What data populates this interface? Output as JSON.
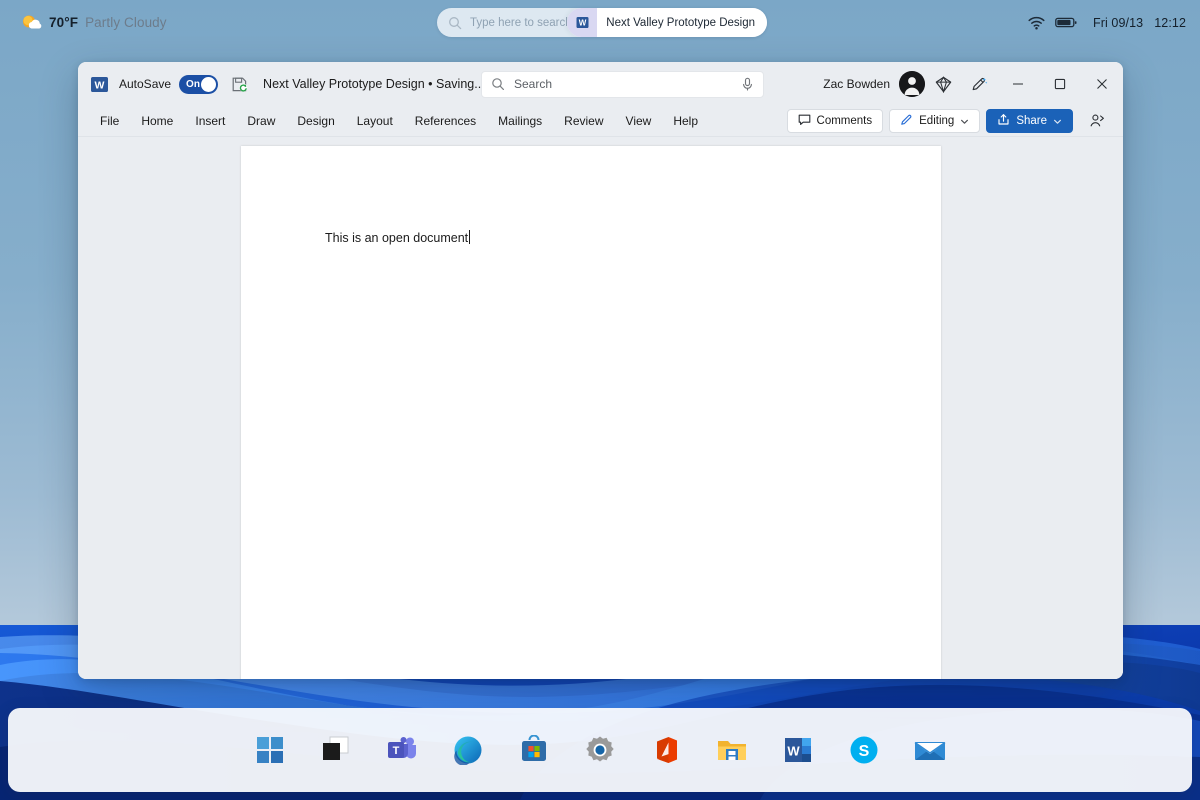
{
  "system": {
    "weather": {
      "temperature": "70°F",
      "condition": "Partly Cloudy",
      "icon": "sun-cloud-icon"
    },
    "taskbar_search": {
      "placeholder": "Type here to search",
      "icon": "search-icon",
      "chip_label": "Next Valley Prototype Design",
      "chip_icon": "word-icon"
    },
    "tray": {
      "wifi_icon": "wifi-icon",
      "battery_icon": "battery-icon",
      "date": "Fri 09/13",
      "time": "12:12"
    }
  },
  "word": {
    "app_icon": "word-icon",
    "autosave": {
      "label": "AutoSave",
      "state": "On",
      "enabled": true
    },
    "save_status_icon": "save-sync-icon",
    "document_title": "Next Valley Prototype Design • Saving...",
    "title_chevron_icon": "chevron-down-icon",
    "search": {
      "placeholder": "Search",
      "icon": "search-icon",
      "mic_icon": "microphone-icon"
    },
    "account": {
      "name": "Zac Bowden",
      "avatar_icon": "user-avatar"
    },
    "title_icons": [
      {
        "name": "diamond-icon"
      },
      {
        "name": "pen-sparkle-icon"
      }
    ],
    "window_controls": {
      "minimize": "minimize-icon",
      "maximize": "maximize-icon",
      "close": "close-icon"
    },
    "ribbon_tabs": [
      {
        "label": "File"
      },
      {
        "label": "Home"
      },
      {
        "label": "Insert"
      },
      {
        "label": "Draw"
      },
      {
        "label": "Design"
      },
      {
        "label": "Layout"
      },
      {
        "label": "References"
      },
      {
        "label": "Mailings"
      },
      {
        "label": "Review"
      },
      {
        "label": "View"
      },
      {
        "label": "Help"
      }
    ],
    "ribbon_actions": {
      "comments": {
        "label": "Comments",
        "icon": "comment-icon"
      },
      "editing": {
        "label": "Editing",
        "icon": "pencil-icon",
        "chevron": "chevron-down-icon"
      },
      "share": {
        "label": "Share",
        "icon": "share-icon",
        "chevron": "chevron-down-icon",
        "color": "#1b62b8"
      },
      "share_person": {
        "icon": "person-share-icon"
      }
    },
    "document": {
      "text": "This is an open document"
    }
  },
  "taskbar_apps": [
    {
      "name": "start-button",
      "label": "Start"
    },
    {
      "name": "task-view-button",
      "label": "Task View"
    },
    {
      "name": "teams-button",
      "label": "Microsoft Teams"
    },
    {
      "name": "edge-button",
      "label": "Microsoft Edge"
    },
    {
      "name": "store-button",
      "label": "Microsoft Store"
    },
    {
      "name": "settings-button",
      "label": "Settings"
    },
    {
      "name": "office-button",
      "label": "Microsoft Office"
    },
    {
      "name": "file-explorer-button",
      "label": "File Explorer"
    },
    {
      "name": "word-button",
      "label": "Microsoft Word"
    },
    {
      "name": "skype-button",
      "label": "Skype"
    },
    {
      "name": "mail-button",
      "label": "Mail"
    }
  ],
  "colors": {
    "word_blue": "#2b579a",
    "accent_blue": "#1b62b8",
    "toggle_on": "#1b4fa5"
  }
}
